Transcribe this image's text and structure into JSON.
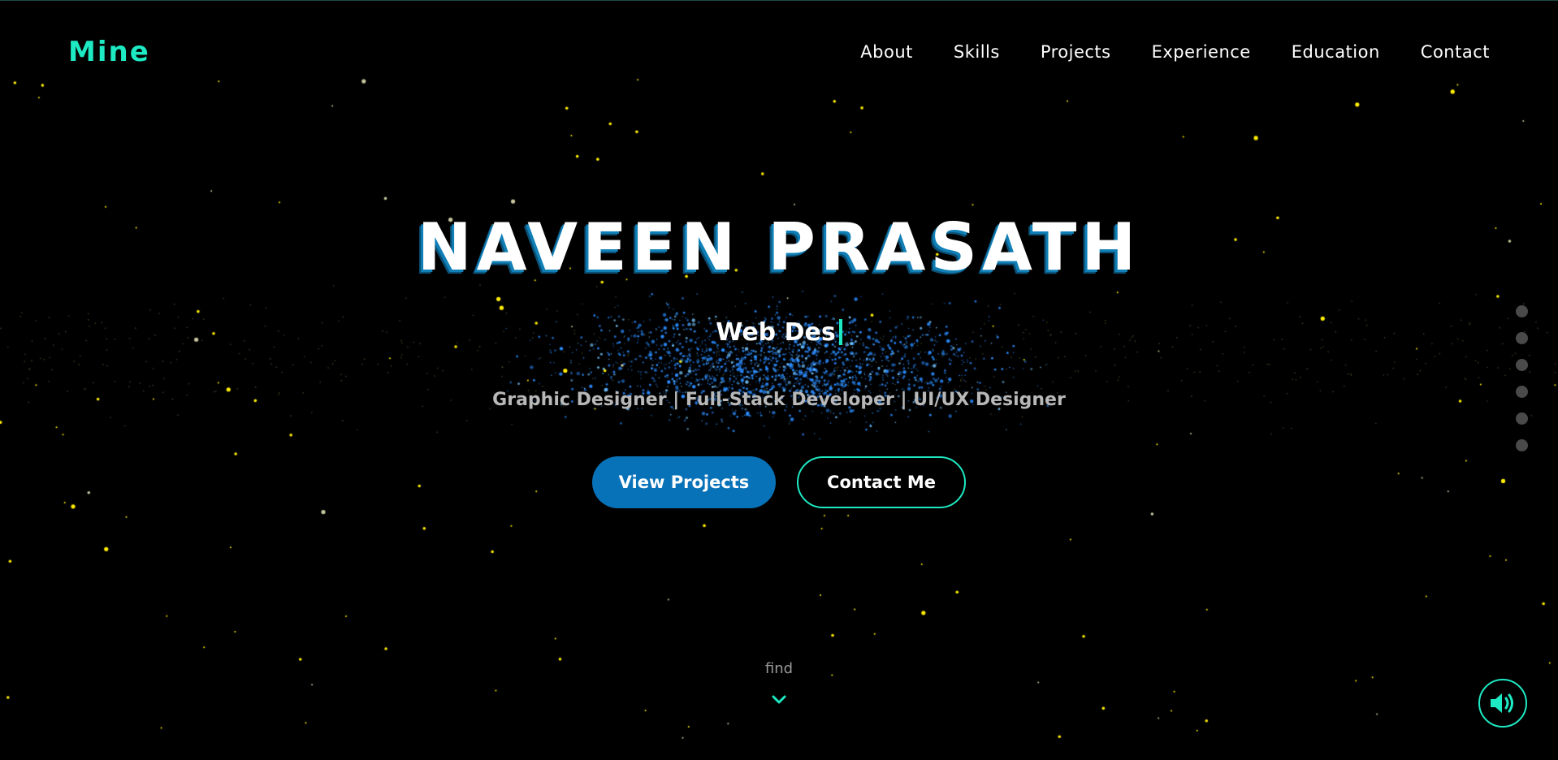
{
  "brand": "Mine",
  "nav": [
    "About",
    "Skills",
    "Projects",
    "Experience",
    "Education",
    "Contact"
  ],
  "hero": {
    "name": "NAVEEN PRASATH",
    "typing_text": "Web Des",
    "roles": "Graphic Designer | Full-Stack Developer | UI/UX Designer"
  },
  "buttons": {
    "primary_label": "View Projects",
    "secondary_label": "Contact Me"
  },
  "scroll_hint": "find",
  "section_dots_count": 6,
  "icons": {
    "scroll": "chevron-down-icon",
    "sound": "volume-icon"
  },
  "colors": {
    "accent": "#1de9c3",
    "primary_button": "#0872b8",
    "background": "#000000",
    "star_yellow": "#ffee00",
    "star_blue": "#2a8cff"
  }
}
